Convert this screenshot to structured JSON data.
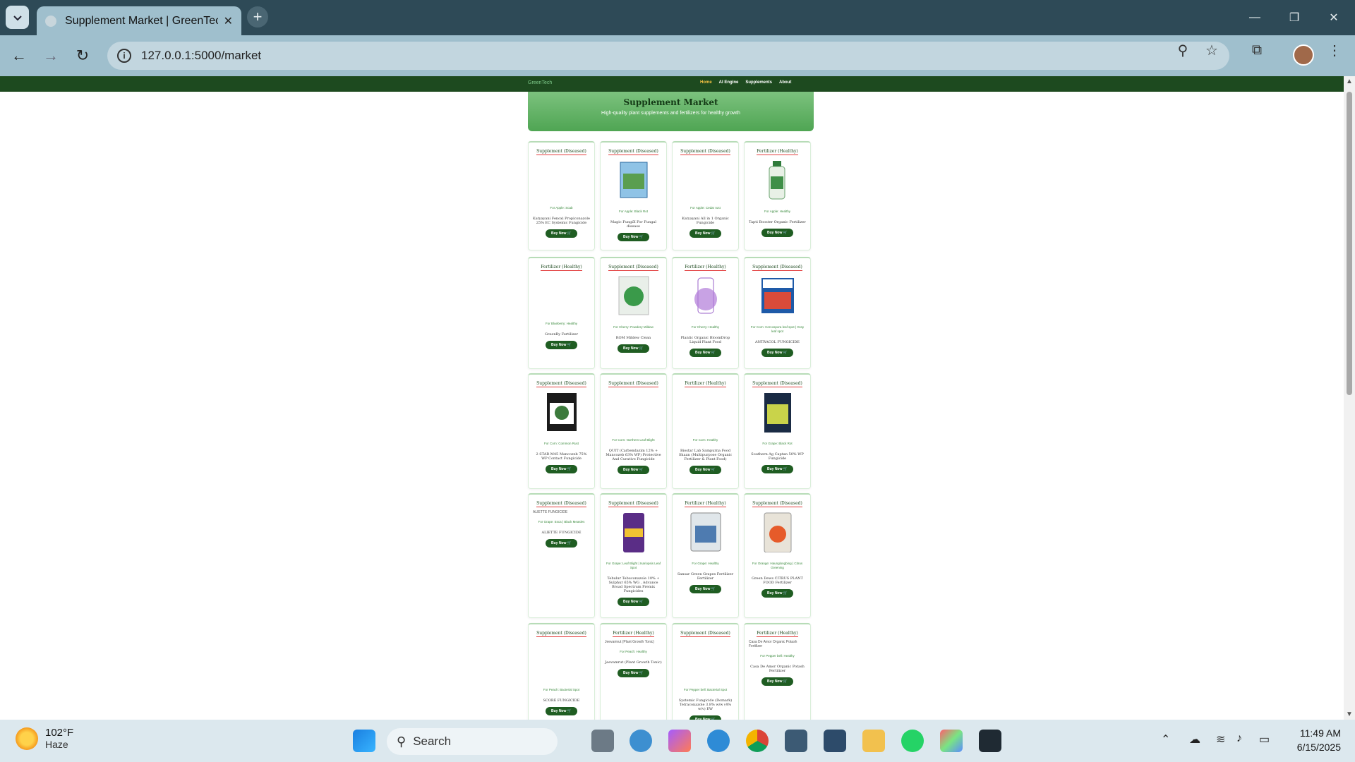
{
  "browser": {
    "tab_title": "Supplement Market | GreenTech",
    "url": "127.0.0.1:5000/market",
    "new_tab": "+",
    "tab_close": "✕"
  },
  "site": {
    "brand": "GreenTech",
    "nav": [
      "Home",
      "AI Engine",
      "Supplements",
      "About"
    ],
    "hero_title": "Supplement Market",
    "hero_subtitle": "High-quality plant supplements and fertilizers for healthy growth",
    "buy_label": "Buy Now"
  },
  "products": [
    {
      "category": "Supplement (Diseased)",
      "for": "For Apple: Scab",
      "name": "Katyayani Fenoxi Propiconazole 25% EC Systemic Fungicide",
      "image": "none"
    },
    {
      "category": "Supplement (Diseased)",
      "for": "For Apple: Black Rot",
      "name": "Magic FungiX For Fungal disease",
      "image": "box"
    },
    {
      "category": "Supplement (Diseased)",
      "for": "For Apple: Cedar rust",
      "name": "Katyayani All in 1 Organic Fungicide",
      "image": "none"
    },
    {
      "category": "Fertilizer (Healthy)",
      "for": "For Apple: Healthy",
      "name": "Tapti Booster Organic Fertilizer",
      "image": "bottle"
    },
    {
      "category": "Fertilizer (Healthy)",
      "for": "For Blueberry: Healthy",
      "name": "GreenBy Fertilizer",
      "image": "none"
    },
    {
      "category": "Supplement (Diseased)",
      "for": "For Cherry: Powdery Mildew",
      "name": "ROM Mildew Clean",
      "image": "bag"
    },
    {
      "category": "Fertilizer (Healthy)",
      "for": "For Cherry: Healthy",
      "name": "Plantic Organic BloomDrop Liquid Plant Food",
      "image": "purple"
    },
    {
      "category": "Supplement (Diseased)",
      "for": "For Corn: Cercospora leaf spot | Gray leaf spot",
      "name": "ANTRACOL FUNGICIDE",
      "image": "antracol"
    },
    {
      "category": "Supplement (Diseased)",
      "for": "For Corn: Common Rust",
      "name": "2 STAR M45 Mancozeb 75% WP Contact Fungicide",
      "image": "star"
    },
    {
      "category": "Supplement (Diseased)",
      "for": "For Corn: Northern Leaf Blight",
      "name": "QUIT (Carbendazim 12% + Mancozeb 63% WP) Protective And Curative Fungicide",
      "image": "none"
    },
    {
      "category": "Fertilizer (Healthy)",
      "for": "For Corn: Healthy",
      "name": "Biostar Lab Sampurna Food Shaan (Multipurpose Organic Fertilizer & Plant Food)",
      "image": "none"
    },
    {
      "category": "Supplement (Diseased)",
      "for": "For Grape: Black Rot",
      "name": "Southern Ag Captan 50% WP Fungicide",
      "image": "dark"
    },
    {
      "category": "Supplement (Diseased)",
      "for": "For Grape: Esca | Black Measles",
      "name": "ALIETTE FUNGICIDE",
      "image": "broken",
      "alt": "ALIETTE FUNGICIDE"
    },
    {
      "category": "Supplement (Diseased)",
      "for": "For Grape: Leaf Blight | Isariopsis Leaf Spot",
      "name": "Tebulur Tebuconazole 10% + Sulphur 65% WG , Advance Broad Spectrum Premix Fungicides",
      "image": "tebulur"
    },
    {
      "category": "Fertilizer (Healthy)",
      "for": "For Grape: Healthy",
      "name": "Sansar Green Grapes Fertilizer Fertilizer",
      "image": "pouch"
    },
    {
      "category": "Supplement (Diseased)",
      "for": "For Orange: Haunglongbing | Citrus Greening",
      "name": "Green Dews CITRUS PLANT FOOD Fertilizer",
      "image": "citrus"
    },
    {
      "category": "Supplement (Diseased)",
      "for": "For Peach: Bacterial Spot",
      "name": "SCORE FUNGICIDE",
      "image": "none"
    },
    {
      "category": "Fertilizer (Healthy)",
      "for": "For Peach: Healthy",
      "name": "Jeevamrut (Plant Growth Tonic)",
      "image": "broken",
      "alt": "Jeevamrut (Plant Growth Tonic)"
    },
    {
      "category": "Supplement (Diseased)",
      "for": "For Pepper bell: Bacterial Spot",
      "name": "Systemic Fungicide (Domark) Tetraconazole 3.8% w/w (4% w/v) EW",
      "image": "none"
    },
    {
      "category": "Fertilizer (Healthy)",
      "for": "For Pepper bell: Healthy",
      "name": "Casa De Amor Organic Potash Fertilizer",
      "image": "broken",
      "alt": "Casa De Amor Organic Potash Fertilizer"
    }
  ],
  "taskbar": {
    "temp": "102°F",
    "weather": "Haze",
    "search": "Search",
    "time": "11:49 AM",
    "date": "6/15/2025"
  }
}
